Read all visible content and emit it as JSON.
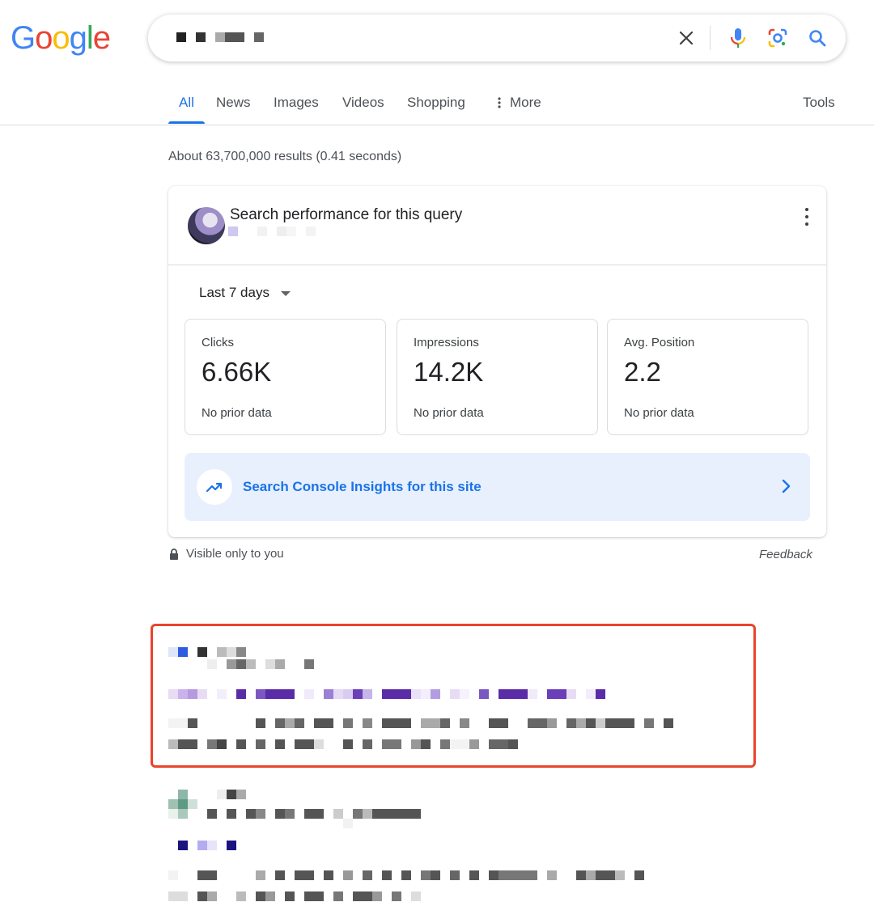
{
  "header": {
    "logo_letters": [
      {
        "ch": "G",
        "color": "#4285F4"
      },
      {
        "ch": "o",
        "color": "#EA4335"
      },
      {
        "ch": "o",
        "color": "#FBBC05"
      },
      {
        "ch": "g",
        "color": "#4285F4"
      },
      {
        "ch": "l",
        "color": "#34A853"
      },
      {
        "ch": "e",
        "color": "#EA4335"
      }
    ],
    "search": {
      "query_redacted": true,
      "clear_icon": "close-icon",
      "voice_icon": "microphone-icon",
      "lens_icon": "lens-icon",
      "search_icon": "search-icon"
    }
  },
  "tabs": {
    "all": "All",
    "news": "News",
    "images": "Images",
    "videos": "Videos",
    "shopping": "Shopping",
    "more": "More",
    "tools": "Tools",
    "active": "All"
  },
  "results_stats": "About 63,700,000 results (0.41 seconds)",
  "performance_card": {
    "title": "Search performance for this query",
    "range": "Last 7 days",
    "metrics": [
      {
        "label": "Clicks",
        "value": "6.66K",
        "note": "No prior data"
      },
      {
        "label": "Impressions",
        "value": "14.2K",
        "note": "No prior data"
      },
      {
        "label": "Avg. Position",
        "value": "2.2",
        "note": "No prior data"
      }
    ],
    "insights_link": "Search Console Insights for this site",
    "visible_note": "Visible only to you",
    "feedback": "Feedback"
  },
  "colors": {
    "accent": "#1a73e8",
    "highlight_border": "#e8452c",
    "insights_bg": "#e8f0fe"
  }
}
